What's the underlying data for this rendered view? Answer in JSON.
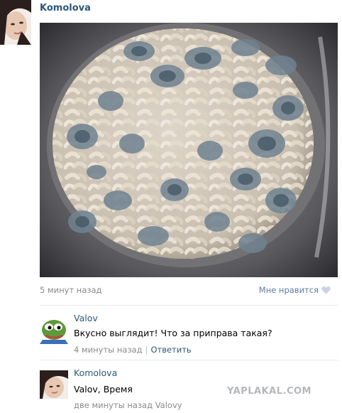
{
  "post": {
    "author": "Komolova",
    "time": "5 минут назад",
    "like_label": "Мне нравится",
    "like_icon": "heart-icon",
    "photo_description_icon": "image-photo"
  },
  "comments": [
    {
      "author": "Valov",
      "text": "Вкусно выглядит! Что за приправа такая?",
      "time": "4 минуты назад",
      "separator": "|",
      "reply_label": "Ответить"
    },
    {
      "author": "Komolova",
      "text": "Valov, Время",
      "time": "две минуты назад Valovy"
    }
  ],
  "watermark": "YAPLAKAL.COM",
  "colors": {
    "link": "#2b587a",
    "meta": "#8a8a8a",
    "like": "#5d7ea0"
  }
}
